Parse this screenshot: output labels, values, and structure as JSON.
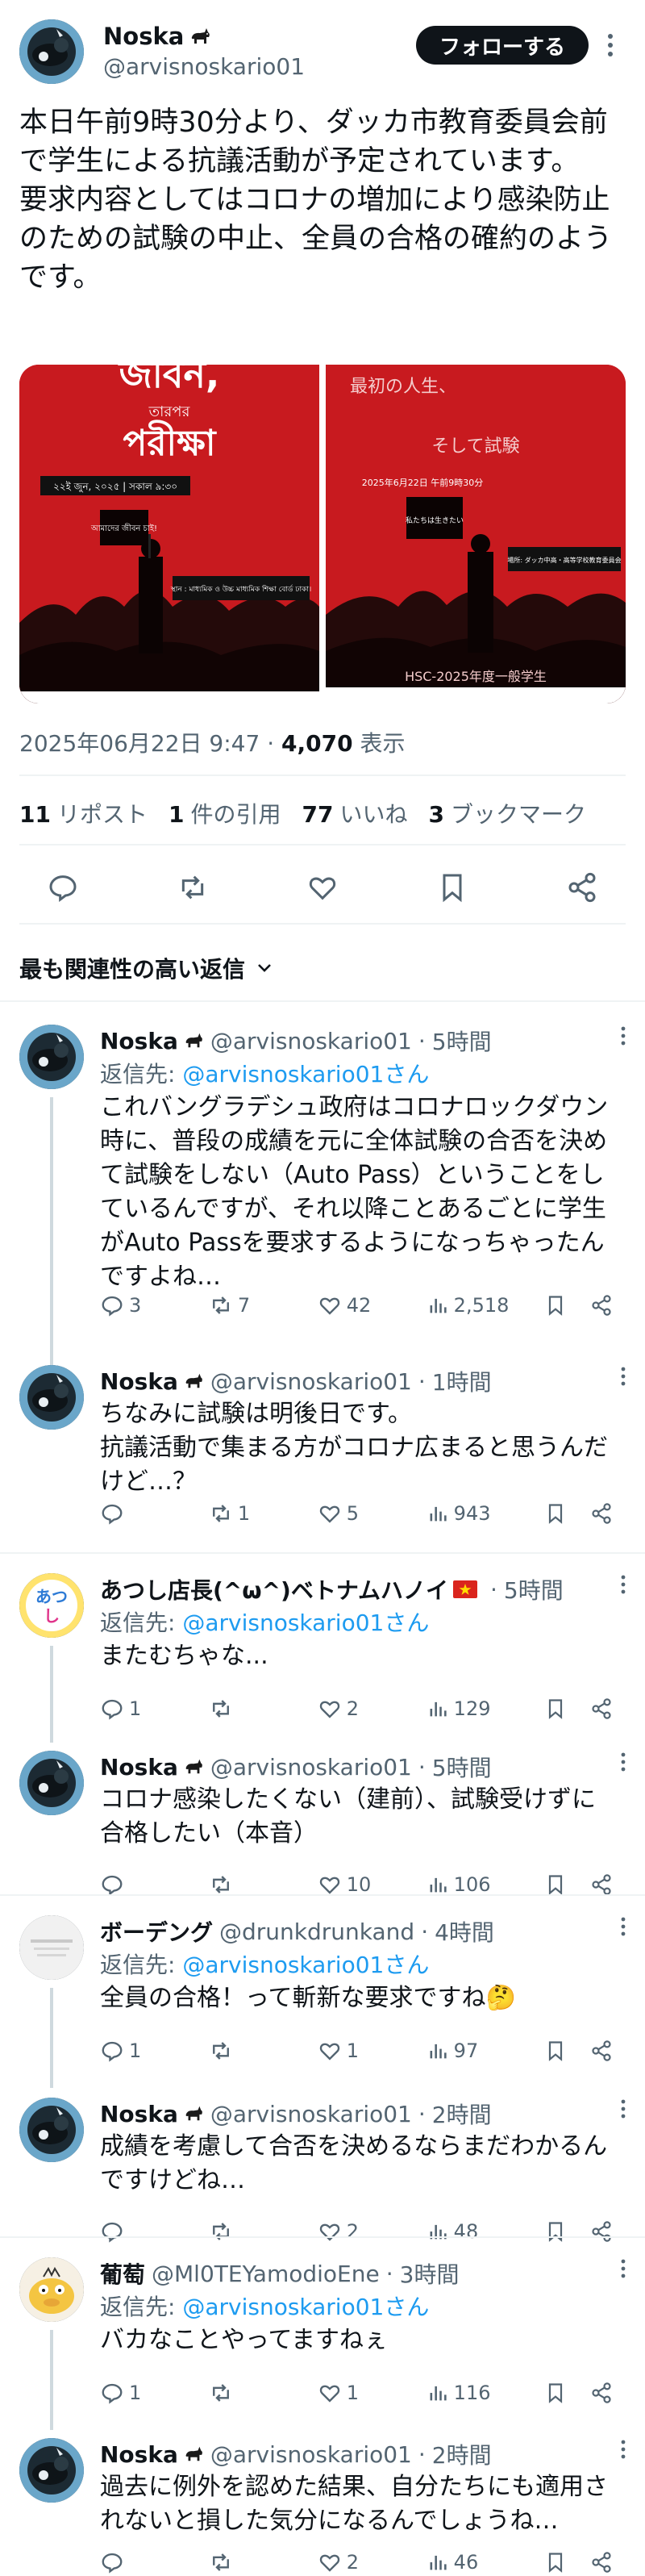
{
  "post": {
    "author_name": "Noska",
    "author_handle": "@arvisnoskario01",
    "follow_label": "フォローする",
    "text": "本日午前9時30分より、ダッカ市教育委員会前で学生による抗議活動が予定されています。\n要求内容としてはコロナの増加により感染防止のための試験の中止、全員の合格の確約のようです。",
    "images": [
      {
        "top_text": "জীবন,",
        "sub_text": "তারপর",
        "main_text": "পরীক্ষা",
        "date_text": "২২ই জুন, ২০২৫ | সকাল ৯:৩০",
        "sign_text": "আমাদের জীবন চাই!",
        "place_text": "স্থান : মাধ্যমিক ও উচ্চ মাধ্যমিক শিক্ষা বোর্ড ঢাকা।"
      },
      {
        "top_text": "最初の人生、",
        "main_text": "そして試験",
        "date_text": "2025年6月22日 午前9時30分",
        "sign_text": "私たちは生きたい",
        "place_text": "場所: ダッカ中高・高等学校教育委員会",
        "bottom_text": "HSC-2025年度一般学生"
      }
    ],
    "timestamp": "2025年06月22日 9:47",
    "views_count": "4,070",
    "views_label": "表示",
    "reposts_count": "11",
    "reposts_label": "リポスト",
    "quotes_count": "1",
    "quotes_label": "件の引用",
    "likes_count": "77",
    "likes_label": "いいね",
    "bookmarks_count": "3",
    "bookmarks_label": "ブックマーク"
  },
  "replies_sort_label": "最も関連性の高い返信",
  "replies": [
    {
      "name": "Noska",
      "handle": "@arvisnoskario01",
      "time": "5時間",
      "reply_to_label": "返信先:",
      "reply_to": "@arvisnoskario01さん",
      "text": "これバングラデシュ政府はコロナロックダウン時に、普段の成績を元に全体試験の合否を決めて試験をしない（Auto Pass）ということをしているんですが、それ以降ことあるごとに学生がAuto Passを要求するようになっちゃったんですよね…",
      "replies": "3",
      "reposts": "7",
      "likes": "42",
      "views": "2,518"
    },
    {
      "name": "Noska",
      "handle": "@arvisnoskario01",
      "time": "1時間",
      "text": "ちなみに試験は明後日です。\n抗議活動で集まる方がコロナ広まると思うんだけど…？",
      "replies": "",
      "reposts": "1",
      "likes": "5",
      "views": "943"
    },
    {
      "name": "あつし店長(^ω^)ベトナムハノイ",
      "handle": "",
      "time": "5時間",
      "reply_to_label": "返信先:",
      "reply_to": "@arvisnoskario01さん",
      "text": "またむちゃな...",
      "replies": "1",
      "reposts": "",
      "likes": "2",
      "views": "129"
    },
    {
      "name": "Noska",
      "handle": "@arvisnoskario01",
      "time": "5時間",
      "text": "コロナ感染したくない（建前）、試験受けずに合格したい（本音）",
      "replies": "",
      "reposts": "",
      "likes": "10",
      "views": "106"
    },
    {
      "name": "ボーデング",
      "handle": "@drunkdrunkand",
      "time": "4時間",
      "reply_to_label": "返信先:",
      "reply_to": "@arvisnoskario01さん",
      "text": "全員の合格！って斬新な要求ですね🤔",
      "replies": "1",
      "reposts": "",
      "likes": "1",
      "views": "97"
    },
    {
      "name": "Noska",
      "handle": "@arvisnoskario01",
      "time": "2時間",
      "text": "成績を考慮して合否を決めるならまだわかるんですけどね…",
      "replies": "",
      "reposts": "",
      "likes": "2",
      "views": "48"
    },
    {
      "name": "葡萄",
      "handle": "@Ml0TEYamodioEne",
      "time": "3時間",
      "reply_to_label": "返信先:",
      "reply_to": "@arvisnoskario01さん",
      "text": "バカなことやってますねぇ",
      "replies": "1",
      "reposts": "",
      "likes": "1",
      "views": "116"
    },
    {
      "name": "Noska",
      "handle": "@arvisnoskario01",
      "time": "2時間",
      "text": "過去に例外を認めた結果、自分たちにも適用されないと損した気分になるんでしょうね…",
      "replies": "",
      "reposts": "",
      "likes": "2",
      "views": "46"
    }
  ],
  "icons": {
    "goat": "goat-icon",
    "flag": "vietnam-flag-icon",
    "verified_badge": "none"
  },
  "colors": {
    "accent": "#1d9bf0",
    "text": "#0f1419",
    "secondary": "#536471",
    "poster_red": "#c4161c"
  }
}
